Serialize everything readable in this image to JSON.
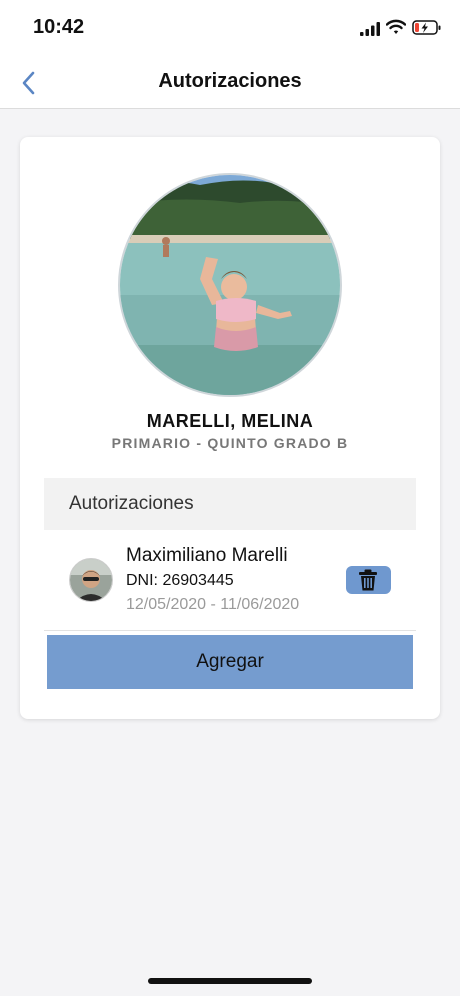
{
  "status_bar": {
    "time": "10:42"
  },
  "nav": {
    "title": "Autorizaciones"
  },
  "student": {
    "name": "MARELLI, MELINA",
    "grade": "PRIMARIO - QUINTO GRADO B"
  },
  "authorizations": {
    "section_title": "Autorizaciones",
    "items": [
      {
        "name": "Maximiliano Marelli",
        "dni": "DNI: 26903445",
        "dates": "12/05/2020 - 11/06/2020"
      }
    ]
  },
  "actions": {
    "add_label": "Agregar"
  },
  "colors": {
    "accent": "#759ccf",
    "back": "#5b86c4"
  },
  "icons": {
    "back": "chevron-left-icon",
    "delete": "trash-icon"
  }
}
